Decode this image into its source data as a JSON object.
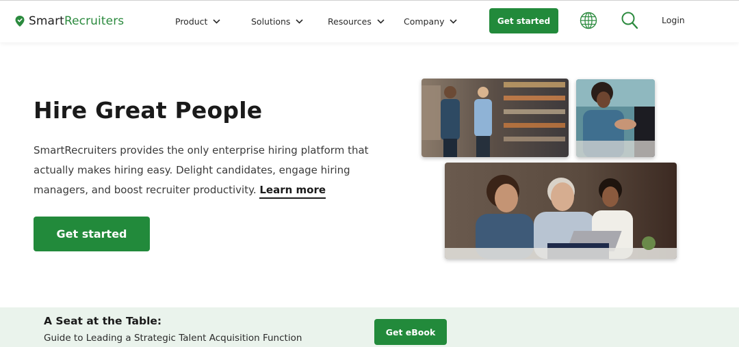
{
  "header": {
    "logo": {
      "prefix": "Smart",
      "suffix": "Recruiters",
      "icon": "location-pin-icon"
    },
    "nav": [
      {
        "label": "Product",
        "icon": "chevron-down-icon"
      },
      {
        "label": "Solutions",
        "icon": "chevron-down-icon"
      },
      {
        "label": "Resources",
        "icon": "chevron-down-icon"
      },
      {
        "label": "Company",
        "icon": "chevron-down-icon"
      }
    ],
    "cta_label": "Get started",
    "globe_icon": "globe-icon",
    "search_icon": "search-icon",
    "login_label": "Login"
  },
  "hero": {
    "title": "Hire Great People",
    "description": "SmartRecruiters provides the only enterprise hiring platform that actually makes hiring easy. Delight candidates, engage hiring managers, and boost recruiter productivity.",
    "learn_more": "Learn more",
    "cta_label": "Get started"
  },
  "banner": {
    "title": "A Seat at the Table:",
    "subtitle": "Guide to Leading a Strategic Talent Acquisition Function",
    "cta_label": "Get eBook"
  },
  "colors": {
    "brand_green": "#228a3b",
    "logo_green": "#2b8a3e",
    "banner_bg": "#eaf3ec"
  }
}
